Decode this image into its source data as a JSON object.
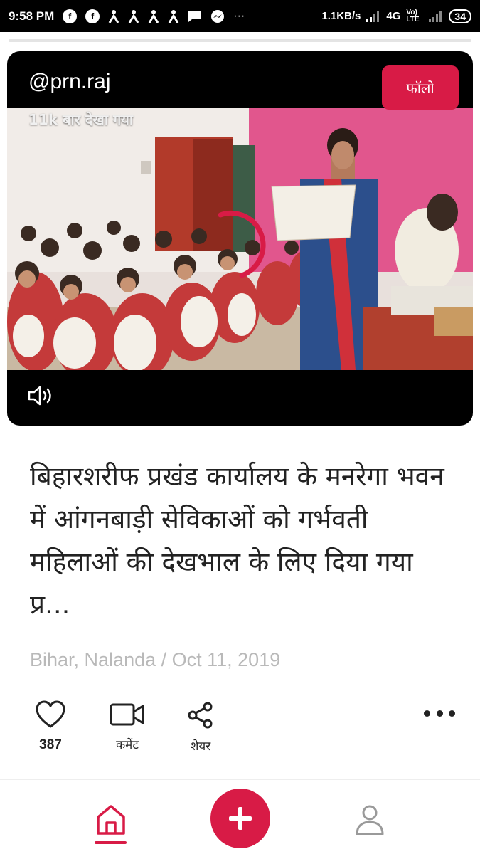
{
  "status_bar": {
    "time": "9:58 PM",
    "network_speed": "1.1KB/s",
    "network_type": "4G",
    "volte_label": "Vo) LTE",
    "battery": "34",
    "notification_icons": [
      "facebook-icon",
      "facebook-icon",
      "person-icon",
      "person-icon",
      "person-icon",
      "person-icon",
      "message-icon",
      "messenger-icon",
      "more-icon"
    ]
  },
  "post": {
    "handle": "@prn.raj",
    "follow_label": "फॉलो",
    "views_label": "11k बार देखा गया",
    "headline": "बिहारशरीफ प्रखंड कार्यालय के मनरेगा भवन में आंगनबाड़ी सेविकाओं को गर्भवती महिलाओं की देखभाल के लिए दिया गया प्र...",
    "location_date": "Bihar, Nalanda / Oct 11, 2019"
  },
  "actions": {
    "like_count": "387",
    "comment_label": "कमेंट",
    "share_label": "शेयर"
  },
  "nav": {
    "items": [
      "home-icon",
      "add-icon",
      "profile-icon"
    ]
  },
  "colors": {
    "accent": "#d81b46",
    "text": "#222222",
    "meta": "#b9b9b9"
  }
}
